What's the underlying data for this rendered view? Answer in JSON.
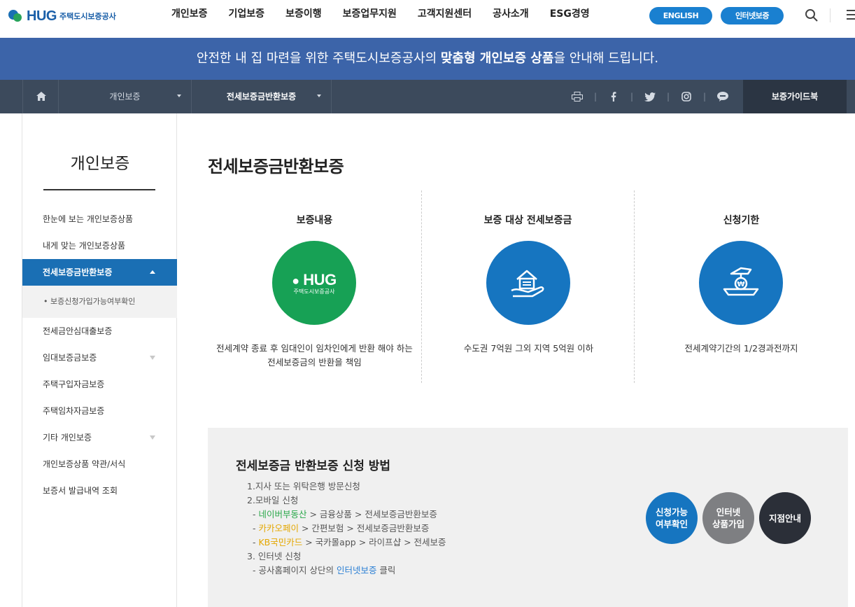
{
  "header": {
    "logo_text": "HUG",
    "logo_sub": "주택도시보증공사",
    "nav": [
      "개인보증",
      "기업보증",
      "보증이행",
      "보증업무지원",
      "고객지원센터",
      "공사소개",
      "ESG경영"
    ],
    "english_label": "ENGLISH",
    "internet_label": "인터넷보증"
  },
  "banner": {
    "text_before": "안전한 내 집 마련을 위한 주택도시보증공사의 ",
    "text_bold": "맞춤형 개인보증 상품",
    "text_after": "을 안내해 드립니다."
  },
  "subnav": {
    "dropdown1": "개인보증",
    "dropdown2": "전세보증금반환보증",
    "guide_label": "보증가이드북"
  },
  "sidebar": {
    "title": "개인보증",
    "items": [
      {
        "label": "한눈에 보는 개인보증상품"
      },
      {
        "label": "내게 맞는 개인보증상품"
      },
      {
        "label": "전세보증금반환보증"
      },
      {
        "label": "• 보증신청가입가능여부확인"
      },
      {
        "label": "전세금안심대출보증"
      },
      {
        "label": "임대보증금보증"
      },
      {
        "label": "주택구입자금보증"
      },
      {
        "label": "주택임차자금보증"
      },
      {
        "label": "기타 개인보증"
      },
      {
        "label": "개인보증상품 약관/서식"
      },
      {
        "label": "보증서 발급내역 조회"
      }
    ]
  },
  "main": {
    "title": "전세보증금반환보증",
    "columns": [
      {
        "title": "보증내용",
        "desc": "전세계약 종료 후 임대인이 임차인에게 반환 해야 하는 전세보증금의 반환을 책임",
        "logo_text": "HUG",
        "logo_sub": "주택도시보증공사"
      },
      {
        "title": "보증 대상 전세보증금",
        "desc": "수도권 7억원 그외 지역 5억원 이하"
      },
      {
        "title": "신청기한",
        "desc": "전세계약기간의 1/2경과전까지"
      }
    ]
  },
  "howto": {
    "title": "전세보증금 반환보증 신청 방법",
    "step1": "1.지사 또는 위탁은행 방문신청",
    "step2": "2.모바일 신청",
    "m1_dash": "- ",
    "m1_hl": "네이버부동산",
    "m1_rest": " > 금융상품 > 전세보증금반환보증",
    "m2_dash": "- ",
    "m2_hl": "카카오페이",
    "m2_rest": " > 간편보험 > 전세보증금반환보증",
    "m3_dash": "- ",
    "m3_hl": "KB국민카드",
    "m3_rest": " > 국카몰app > 라이프샵 > 전세보증",
    "step3": "3. 인터넷 신청",
    "i1_pre": "- 공사홈페이지 상단의 ",
    "i1_hl": "인터넷보증",
    "i1_post": " 클릭",
    "btn1_l1": "신청가능",
    "btn1_l2": "여부확인",
    "btn2_l1": "인터넷",
    "btn2_l2": "상품가입",
    "btn3": "지점안내"
  }
}
